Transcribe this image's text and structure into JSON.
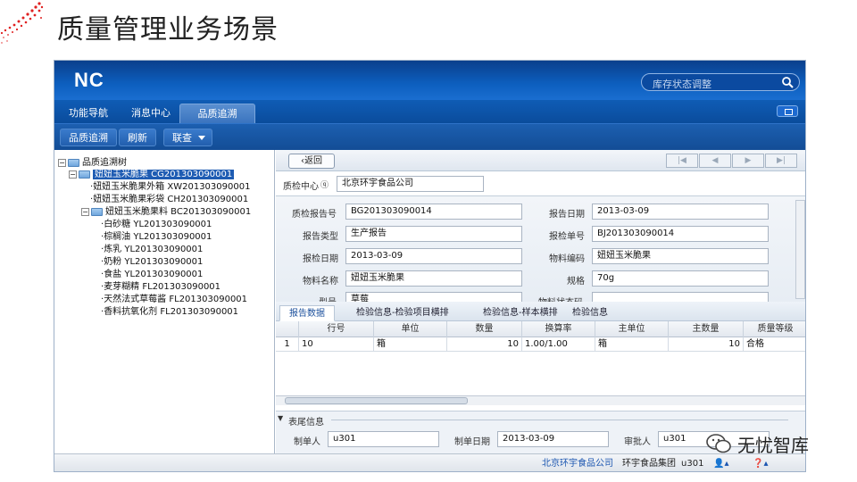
{
  "slide": {
    "title": "质量管理业务场景"
  },
  "app": {
    "logo": "NC",
    "search_placeholder": "库存状态调整",
    "tabs": [
      "功能导航",
      "消息中心",
      "品质追溯"
    ],
    "active_tab": 2,
    "toolbar": [
      "品质追溯",
      "刷新",
      "联查"
    ]
  },
  "tree": {
    "root": "品质追溯树",
    "nodes": [
      {
        "label": "妞妞玉米脆果  CG201303090001",
        "level": 1,
        "folder": true,
        "selected": true
      },
      {
        "label": "妞妞玉米脆果外箱  XW201303090001",
        "level": 2
      },
      {
        "label": "妞妞玉米脆果彩袋  CH201303090001",
        "level": 2
      },
      {
        "label": "妞妞玉米脆果料  BC201303090001",
        "level": 2,
        "folder": true
      },
      {
        "label": "白砂糖  YL201303090001",
        "level": 3
      },
      {
        "label": "棕榈油  YL201303090001",
        "level": 3
      },
      {
        "label": "炼乳  YL201303090001",
        "level": 3
      },
      {
        "label": "奶粉  YL201303090001",
        "level": 3
      },
      {
        "label": "食盐  YL201303090001",
        "level": 3
      },
      {
        "label": "麦芽糊精  FL201303090001",
        "level": 3
      },
      {
        "label": "天然法式草莓酱  FL201303090001",
        "level": 3
      },
      {
        "label": "香料抗氧化剂  FL201303090001",
        "level": 3
      }
    ]
  },
  "detail": {
    "back": "返回",
    "qc_center_label": "质检中心",
    "qc_center_value": "北京环宇食品公司",
    "fields": {
      "report_no": {
        "label": "质检报告号",
        "value": "BG201303090014"
      },
      "report_date": {
        "label": "报告日期",
        "value": "2013-03-09"
      },
      "report_type": {
        "label": "报告类型",
        "value": "生产报告"
      },
      "request_no": {
        "label": "报检单号",
        "value": "BJ201303090014"
      },
      "request_date": {
        "label": "报检日期",
        "value": "2013-03-09"
      },
      "material_code": {
        "label": "物料编码",
        "value": "妞妞玉米脆果"
      },
      "material_name": {
        "label": "物料名称",
        "value": "妞妞玉米脆果"
      },
      "spec": {
        "label": "规格",
        "value": "70g"
      },
      "partial_left": {
        "label": "型号",
        "value": "草莓"
      },
      "partial_right": {
        "label": "物料状态码",
        "value": ""
      }
    },
    "tabs": [
      "报告数据",
      "检验信息-检验项目横排",
      "检验信息-样本横排",
      "检验信息"
    ],
    "grid": {
      "headers": [
        "行号",
        "单位",
        "数量",
        "换算率",
        "主单位",
        "主数量",
        "质量等级"
      ],
      "rows": [
        [
          "1",
          "10",
          "箱",
          "10",
          "1.00/1.00",
          "箱",
          "10",
          "合格"
        ]
      ]
    },
    "footer": {
      "section": "表尾信息",
      "creator": {
        "label": "制单人",
        "value": "u301"
      },
      "create_date": {
        "label": "制单日期",
        "value": "2013-03-09"
      },
      "approver": {
        "label": "审批人",
        "value": "u301"
      }
    }
  },
  "statusbar": {
    "company": "北京环宇食品公司",
    "group": "环宇食品集团",
    "user": "u301"
  },
  "watermark": "无忧智库",
  "colors": {
    "topbar": "#0d5fbf",
    "selected": "#1e5cb3",
    "active_tab_text": "#1a4f9c"
  }
}
